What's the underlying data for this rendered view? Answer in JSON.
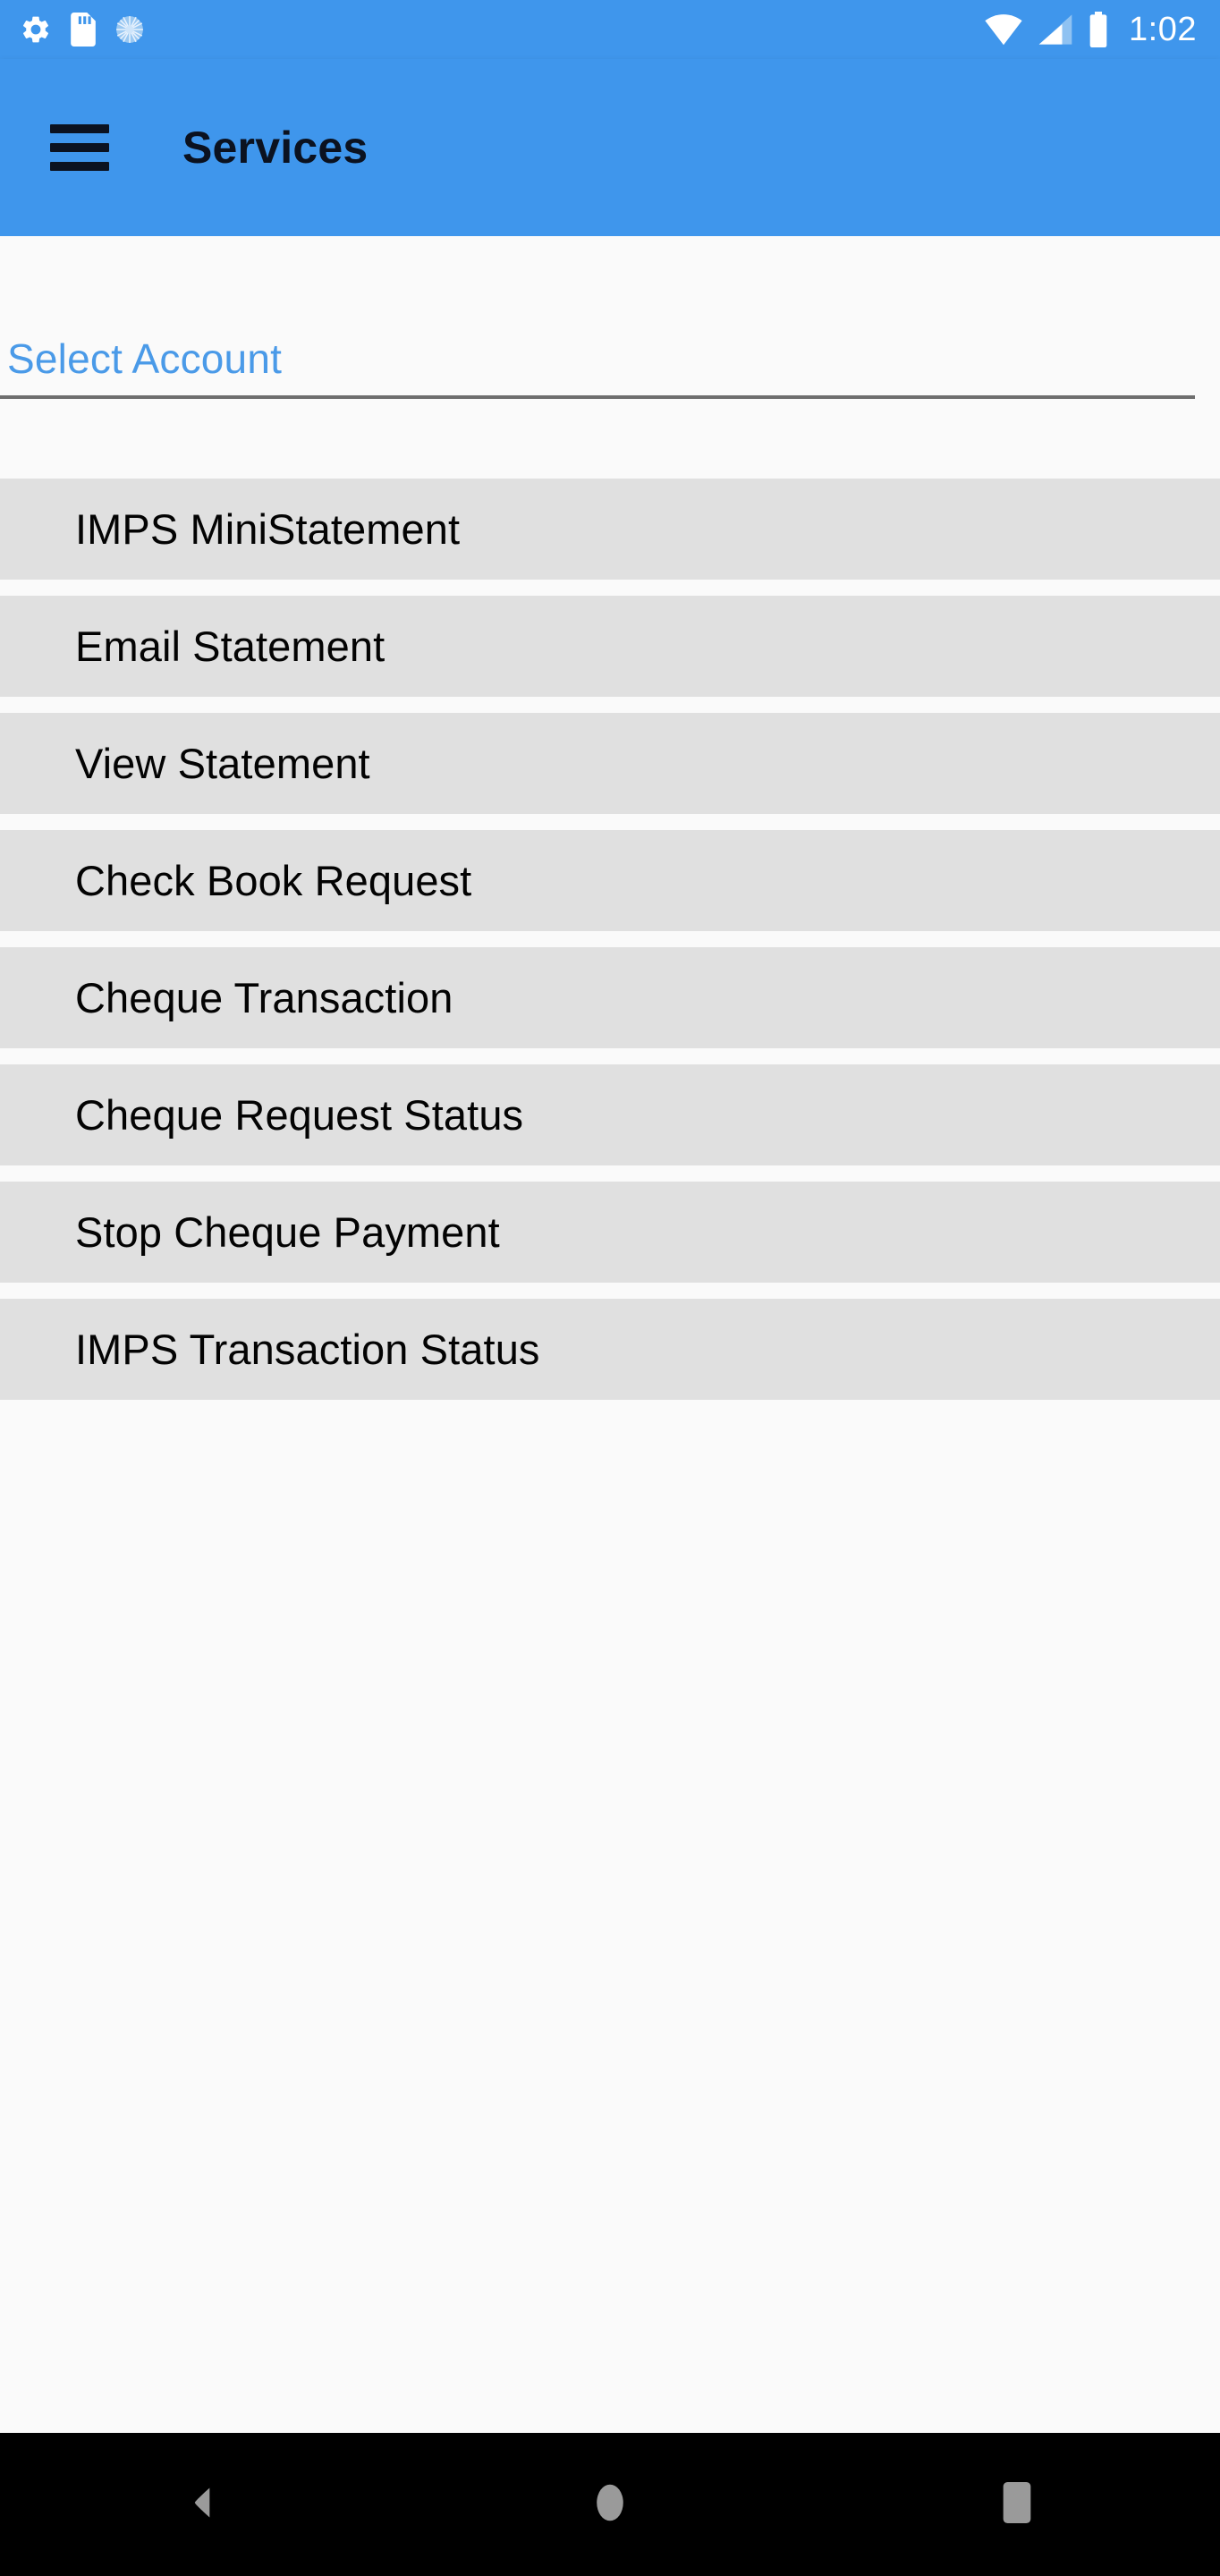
{
  "status_bar": {
    "icons_left": [
      "settings-gear-icon",
      "sd-card-icon",
      "sync-circle-icon"
    ],
    "icons_right": [
      "wifi-icon",
      "cellular-signal-icon",
      "battery-icon"
    ],
    "time": "1:02"
  },
  "toolbar": {
    "menu_icon": "hamburger-menu-icon",
    "title": "Services"
  },
  "account_selector": {
    "label": "Select Account"
  },
  "services": {
    "items": [
      {
        "label": "IMPS MiniStatement"
      },
      {
        "label": "Email Statement"
      },
      {
        "label": "View Statement"
      },
      {
        "label": "Check Book Request"
      },
      {
        "label": "Cheque Transaction"
      },
      {
        "label": "Cheque Request Status"
      },
      {
        "label": "Stop Cheque Payment"
      },
      {
        "label": "IMPS Transaction Status"
      }
    ]
  },
  "nav_bar": {
    "back_label": "back-triangle-icon",
    "home_label": "home-circle-icon",
    "recents_label": "recents-square-icon"
  },
  "colors": {
    "accent": "#3f96ec",
    "row_background": "#e0e0e0",
    "page_background": "#fafafa",
    "link_blue": "#4a9ae8",
    "nav_background": "#000000",
    "nav_icon": "#9a9a9a"
  }
}
